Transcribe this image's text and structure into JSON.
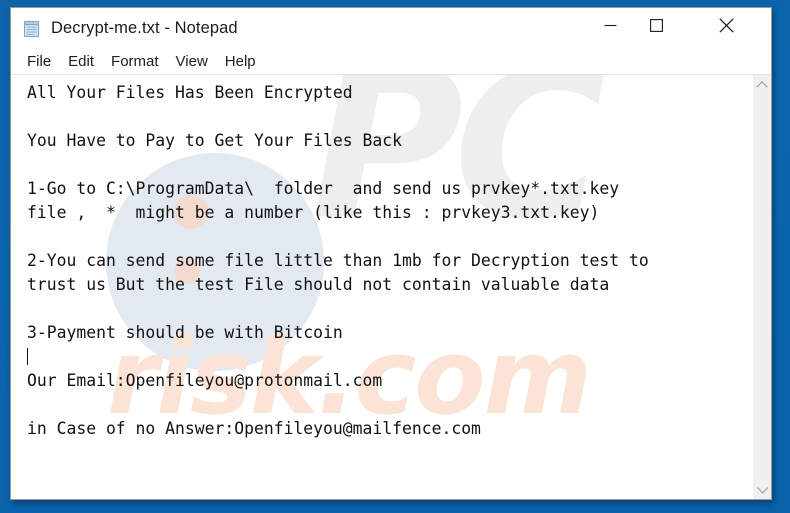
{
  "desktop": {
    "background_color": "#0a63ad"
  },
  "window": {
    "title": "Decrypt-me.txt - Notepad",
    "icon": "notepad-icon",
    "controls": {
      "minimize": "—",
      "maximize": "☐",
      "close": "✕"
    }
  },
  "menubar": {
    "items": [
      {
        "label": "File"
      },
      {
        "label": "Edit"
      },
      {
        "label": "Format"
      },
      {
        "label": "View"
      },
      {
        "label": "Help"
      }
    ]
  },
  "editor": {
    "body": "All Your Files Has Been Encrypted\n\nYou Have to Pay to Get Your Files Back\n\n1-Go to C:\\ProgramData\\  folder  and send us prvkey*.txt.key\nfile ,  *  might be a number (like this : prvkey3.txt.key)\n\n2-You can send some file little than 1mb for Decryption test to\ntrust us But the test File should not contain valuable data\n\n3-Payment should be with Bitcoin\n",
    "body_tail": "\nOur Email:Openfileyou@protonmail.com\n\nin Case of no Answer:Openfileyou@mailfence.com",
    "lines": [
      "All Your Files Has Been Encrypted",
      "",
      "You Have to Pay to Get Your Files Back",
      "",
      "1-Go to C:\\ProgramData\\  folder  and send us prvkey*.txt.key",
      "file ,  *  might be a number (like this : prvkey3.txt.key)",
      "",
      "2-You can send some file little than 1mb for Decryption test to",
      "trust us But the test File should not contain valuable data",
      "",
      "3-Payment should be with Bitcoin",
      "",
      "",
      "Our Email:Openfileyou@protonmail.com",
      "",
      "in Case of no Answer:Openfileyou@mailfence.com"
    ],
    "contacts": {
      "primary_email": "Openfileyou@protonmail.com",
      "secondary_email": "Openfileyou@mailfence.com"
    },
    "payment_method": "Bitcoin",
    "key_file_pattern": "prvkey*.txt.key",
    "key_file_example": "prvkey3.txt.key",
    "key_folder": "C:\\ProgramData\\",
    "test_file_limit": "1mb",
    "caret_line_index": 12,
    "text_color": "#111111",
    "background_color": "#ffffff"
  },
  "watermark": {
    "logo_text": "PC",
    "site_text": "risk.com",
    "logo_color": "#eeeeee",
    "site_color": "#fbe3d6",
    "circle_color": "#dde5ef",
    "dot_color": "#f6d7cb"
  },
  "scrollbar": {
    "up_arrow": "chevron-up",
    "down_arrow": "chevron-down",
    "track_color": "#f0f0f0"
  }
}
